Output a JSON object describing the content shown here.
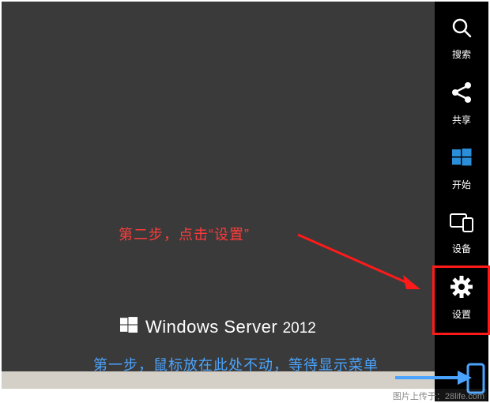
{
  "steps": {
    "step2": "第二步，点击“设置”",
    "step1": "第一步，鼠标放在此处不动，等待显示菜单"
  },
  "brand": {
    "name": "Windows Server",
    "year": "2012"
  },
  "charms": {
    "search": "搜索",
    "share": "共享",
    "start": "开始",
    "devices": "设备",
    "settings": "设置"
  },
  "watermark": "图片上传于：28life.com",
  "colors": {
    "annotation_red": "#ff3a3a",
    "annotation_blue": "#4aa4ff",
    "highlight_border": "#ff1a1a"
  }
}
